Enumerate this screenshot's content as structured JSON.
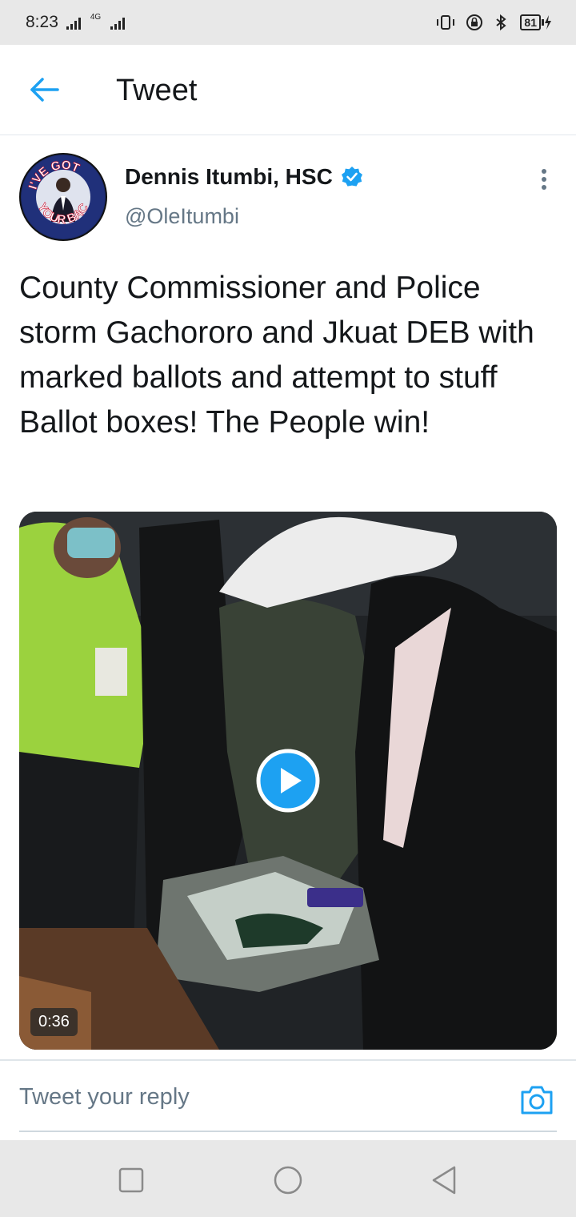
{
  "status_bar": {
    "time": "8:23",
    "network": "4G",
    "battery": "81"
  },
  "header": {
    "title": "Tweet",
    "back_icon": "arrow-left-icon"
  },
  "tweet": {
    "author_name": "Dennis Itumbi, HSC",
    "author_handle": "@OleItumbi",
    "verified": true,
    "avatar_text": [
      "I'VE GOT",
      "YOUR BACK"
    ],
    "text": "County Commissioner and Police storm Gachororo and Jkuat DEB with marked ballots and attempt to stuff Ballot boxes! The People win!",
    "video": {
      "duration": "0:36"
    }
  },
  "reply": {
    "placeholder": "Tweet your reply"
  },
  "colors": {
    "accent": "#1da1f2",
    "text": "#14171a",
    "secondary": "#657786"
  }
}
